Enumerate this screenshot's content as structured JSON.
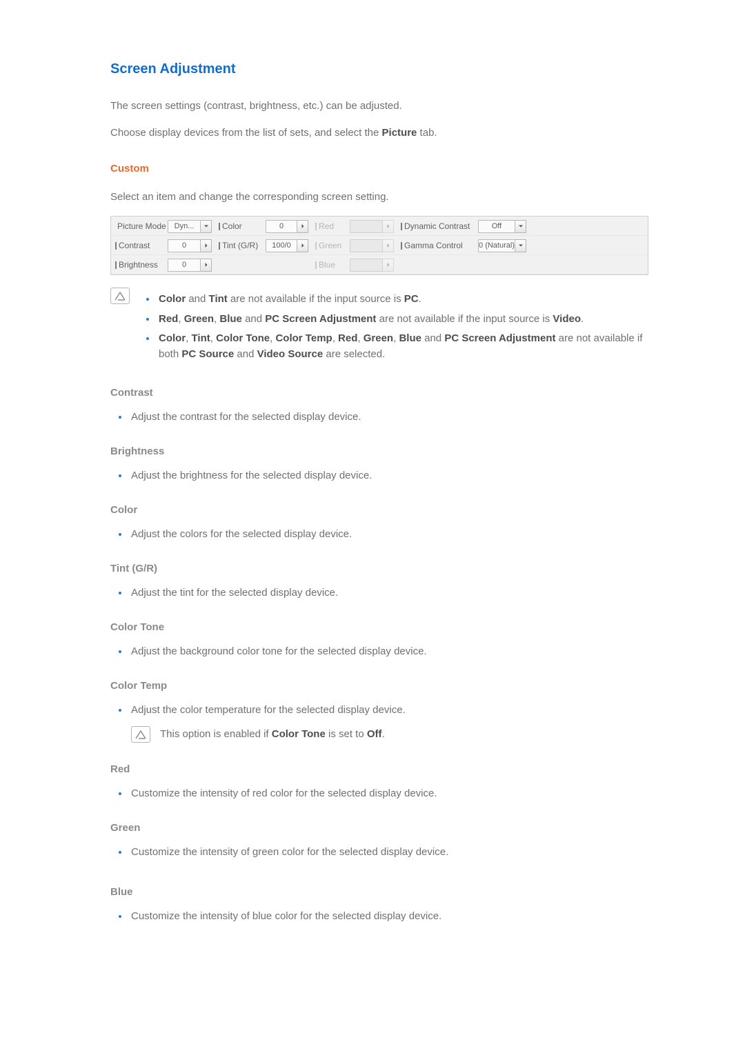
{
  "title": "Screen Adjustment",
  "intro1": "The screen settings (contrast, brightness, etc.) can be adjusted.",
  "intro2_a": "Choose display devices from the list of sets, and select the ",
  "intro2_b": "Picture",
  "intro2_c": " tab.",
  "custom": {
    "heading": "Custom",
    "desc": "Select an item and change the corresponding screen setting."
  },
  "panel": {
    "pictureMode": {
      "label": "Picture Mode",
      "value": "Dyn...",
      "type": "drop",
      "disabled": false
    },
    "contrast": {
      "label": "Contrast",
      "value": "0",
      "type": "spin",
      "disabled": false
    },
    "brightness": {
      "label": "Brightness",
      "value": "0",
      "type": "spin",
      "disabled": false
    },
    "color": {
      "label": "Color",
      "value": "0",
      "type": "spin",
      "disabled": false
    },
    "tint": {
      "label": "Tint (G/R)",
      "value": "100/0",
      "type": "spin",
      "disabled": false
    },
    "red": {
      "label": "Red",
      "value": "",
      "type": "spin",
      "disabled": true
    },
    "green": {
      "label": "Green",
      "value": "",
      "type": "spin",
      "disabled": true
    },
    "blue": {
      "label": "Blue",
      "value": "",
      "type": "spin",
      "disabled": true
    },
    "dynContrast": {
      "label": "Dynamic Contrast",
      "value": "Off",
      "type": "drop",
      "disabled": false
    },
    "gamma": {
      "label": "Gamma Control",
      "value": "0 (Natural)",
      "type": "drop",
      "disabled": false
    }
  },
  "notes": [
    {
      "b": [
        "Color",
        "Tint"
      ],
      "txt": " are not available if the input source is ",
      "b2": "PC",
      "tail": "."
    },
    {
      "b": [
        "Red",
        "Green",
        "Blue",
        "PC Screen Adjustment"
      ],
      "txt": " are not available if the input source is ",
      "b2": "Video",
      "tail": "."
    },
    {
      "b": [
        "Color",
        "Tint",
        "Color Tone",
        "Color Temp",
        "Red",
        "Green",
        "Blue",
        "PC Screen Adjustment"
      ],
      "txt": " are not available if both ",
      "b2": "PC Source",
      "mid": " and ",
      "b3": "Video Source",
      "tail": " are selected."
    }
  ],
  "sections": {
    "contrast": {
      "h": "Contrast",
      "li": "Adjust the contrast for the selected display device."
    },
    "brightness": {
      "h": "Brightness",
      "li": "Adjust the brightness for the selected display device."
    },
    "color": {
      "h": "Color",
      "li": "Adjust the colors for the selected display device."
    },
    "tint": {
      "h": "Tint (G/R)",
      "li": "Adjust the tint for the selected display device."
    },
    "colortone": {
      "h": "Color Tone",
      "li": "Adjust the background color tone for the selected display device."
    },
    "colortemp": {
      "h": "Color Temp",
      "li": "Adjust the color temperature for the selected display device.",
      "note_a": "This option is enabled if ",
      "note_b": "Color Tone",
      "note_c": " is set to ",
      "note_d": "Off",
      "note_e": "."
    },
    "red": {
      "h": "Red",
      "li": "Customize the intensity of red color for the selected display device."
    },
    "green": {
      "h": "Green",
      "li": "Customize the intensity of green color for the selected display device."
    },
    "blue": {
      "h": "Blue",
      "li": "Customize the intensity of blue color for the selected display device."
    }
  }
}
